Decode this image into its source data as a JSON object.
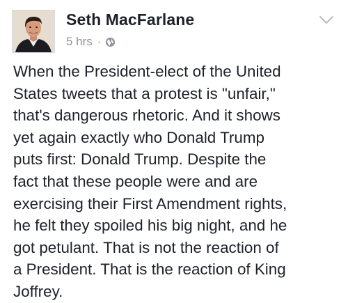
{
  "post": {
    "author": "Seth MacFarlane",
    "timestamp": "5 hrs",
    "separator": "·",
    "privacy_icon": "globe-icon",
    "menu_icon": "chevron-down-icon",
    "text": "When the President-elect of the United\nStates tweets that a protest is \"unfair,\"\nthat's dangerous rhetoric.  And it shows\nyet again exactly who Donald Trump\nputs first: Donald Trump.  Despite the\nfact that these people were and are\nexercising their First Amendment rights,\nhe felt they spoiled his big night, and he\ngot petulant.  That is not the reaction of\na President.  That is the reaction of King\nJoffrey."
  },
  "colors": {
    "author": "#1d2129",
    "meta": "#90949c",
    "text": "#1d2129"
  }
}
